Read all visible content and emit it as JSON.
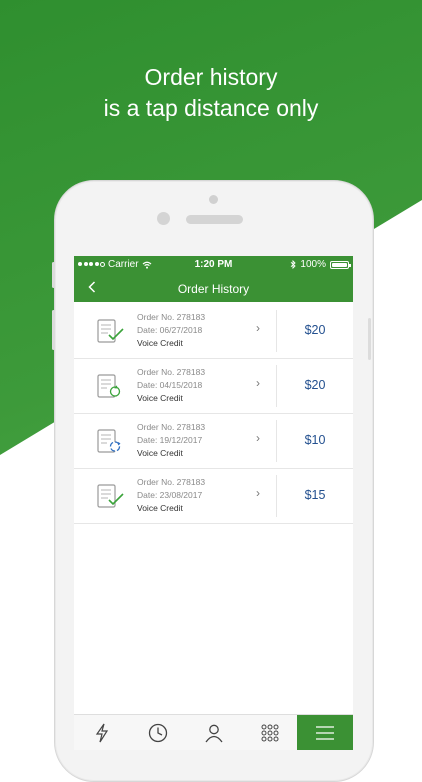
{
  "headline": {
    "line1": "Order history",
    "line2": "is a tap distance only"
  },
  "status_bar": {
    "carrier": "Carrier",
    "time": "1:20 PM",
    "battery": "100%"
  },
  "nav": {
    "title": "Order History",
    "back_icon": "chevron-left-icon"
  },
  "orders": [
    {
      "order_no": "Order No. 278183",
      "date": "Date: 06/27/2018",
      "type": "Voice Credit",
      "price": "$20",
      "status_icon": "check-icon"
    },
    {
      "order_no": "Order No. 278183",
      "date": "Date: 04/15/2018",
      "type": "Voice Credit",
      "price": "$20",
      "status_icon": "refresh-icon"
    },
    {
      "order_no": "Order No. 278183",
      "date": "Date: 19/12/2017",
      "type": "Voice Credit",
      "price": "$10",
      "status_icon": "sync-icon"
    },
    {
      "order_no": "Order No. 278183",
      "date": "Date: 23/08/2017",
      "type": "Voice Credit",
      "price": "$15",
      "status_icon": "check-icon"
    }
  ],
  "tabs": [
    {
      "icon": "lightning-icon",
      "active": false
    },
    {
      "icon": "clock-icon",
      "active": false
    },
    {
      "icon": "person-icon",
      "active": false
    },
    {
      "icon": "dialpad-icon",
      "active": false
    },
    {
      "icon": "menu-icon",
      "active": true
    }
  ],
  "colors": {
    "brand_green": "#3b9134",
    "price_blue": "#23508f",
    "status_green": "#3aa33a",
    "status_blue": "#2f6fc0"
  }
}
